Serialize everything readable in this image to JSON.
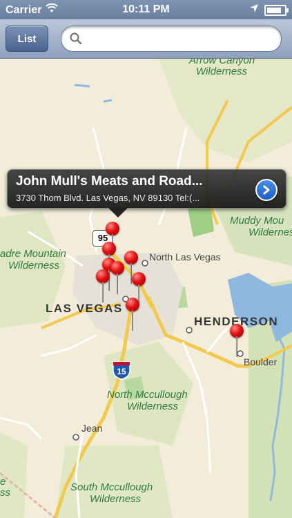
{
  "status_bar": {
    "carrier": "Carrier",
    "time": "10:11 PM",
    "battery_level": 0.85,
    "icons": [
      "wifi-icon",
      "location-arrow-icon",
      "battery-icon"
    ]
  },
  "nav": {
    "list_label": "List",
    "search": {
      "value": "",
      "placeholder": ""
    }
  },
  "map": {
    "labels": {
      "arrow_canyon_1": "Arrow Canyon",
      "arrow_canyon_2": "Wilderness",
      "muddy_1": "Muddy Mou",
      "muddy_2": "Wilderness",
      "madre_1": "adre Mountain",
      "madre_2": "Wilderness",
      "north_las_vegas": "North Las Vegas",
      "las_vegas": "LAS VEGAS",
      "henderson": "HENDERSON",
      "boulder": "Boulder",
      "north_mccullough_1": "North Mccullough",
      "north_mccullough_2": "Wilderness",
      "jean": "Jean",
      "south_mccullough_1": "South Mccullough",
      "south_mccullough_2": "Wilderness",
      "edge_e": "e",
      "edge_ss": "ss"
    },
    "highway_95": "95",
    "interstate_15": "15",
    "interstate_15_label": "Interstate 15",
    "pin_count": 9
  },
  "callout": {
    "title": "John Mull's Meats and Road...",
    "subtitle": "3730 Thom Blvd. Las Vegas, NV 89130 Tel:(..."
  },
  "colors": {
    "land": "#f3ecd8",
    "water": "#8fb8e0",
    "green_area": "#b9d7a6",
    "road_yellow": "#f2c94c",
    "pin_red": "#e01010",
    "disclosure_blue": "#2a6fd6"
  }
}
